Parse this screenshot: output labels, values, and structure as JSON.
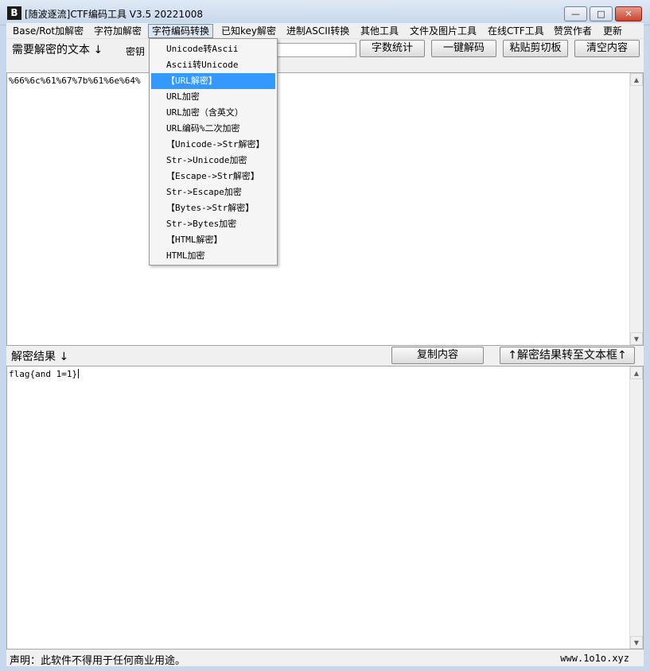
{
  "window": {
    "title": "[随波逐流]CTF编码工具 V3.5 20221008",
    "icon_text": "B",
    "controls": {
      "minimize": "—",
      "maximize": "□",
      "close": "✕"
    }
  },
  "menu": [
    "Base/Rot加解密",
    "字符加解密",
    "字符编码转换",
    "已知key解密",
    "进制ASCII转换",
    "其他工具",
    "文件及图片工具",
    "在线CTF工具",
    "赞赏作者",
    "更新"
  ],
  "toolbar": {
    "input_label": "需要解密的文本 ↓",
    "key_label": "密钥",
    "key_value": "",
    "buttons": [
      "字数统计",
      "一键解码",
      "粘贴剪切板",
      "清空内容"
    ]
  },
  "input_text": "%66%6c%61%67%7b%61%6e%64%",
  "result_bar": {
    "label": "解密结果 ↓",
    "copy_button": "复制内容",
    "transfer_button": "↑解密结果转至文本框↑"
  },
  "output_text": "flag{and 1=1}",
  "status": {
    "disclaimer": "声明：此软件不得用于任何商业用途。",
    "website": "www.1o1o.xyz"
  },
  "dropdown": {
    "items": [
      "Unicode转Ascii",
      "Ascii转Unicode",
      "【URL解密】",
      "URL加密",
      "URL加密（含英文）",
      "URL编码%二次加密",
      "【Unicode->Str解密】",
      "Str->Unicode加密",
      "【Escape->Str解密】",
      "Str->Escape加密",
      "【Bytes->Str解密】",
      "Str->Bytes加密",
      "【HTML解密】",
      "HTML加密"
    ],
    "highlighted": "【URL解密】"
  },
  "scroll_icons": {
    "up": "▲",
    "down": "▼"
  }
}
